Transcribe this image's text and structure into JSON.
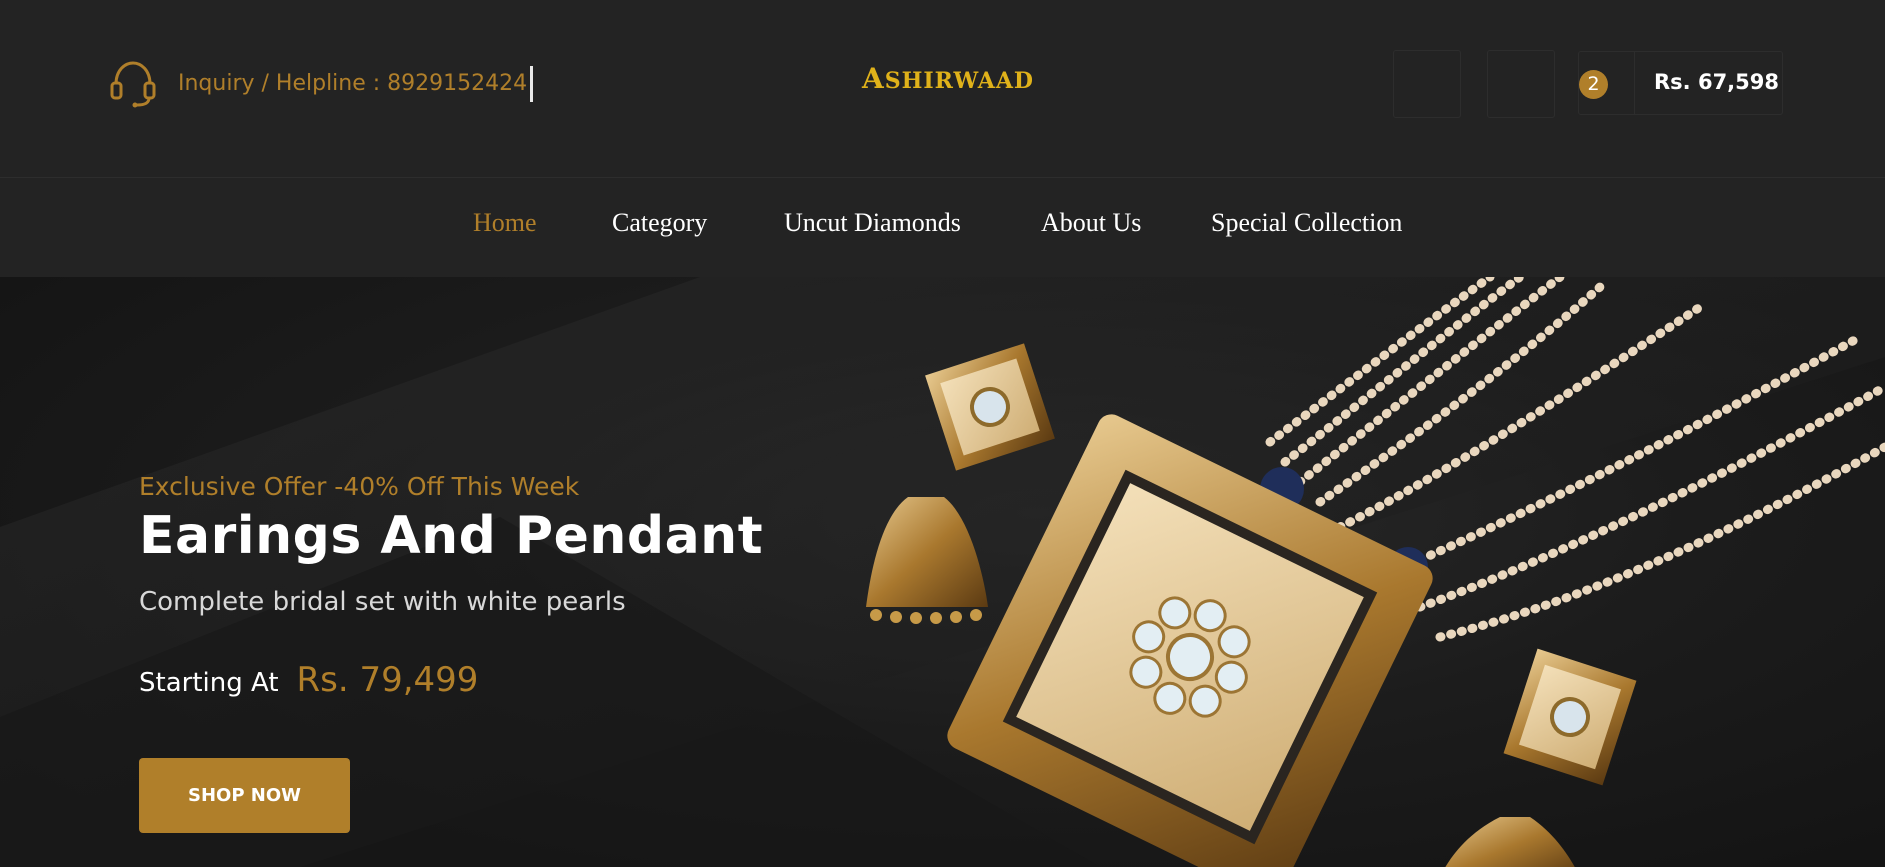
{
  "header": {
    "helpline_text": "Inquiry / Helpline : 8929152424",
    "logo_first": "A",
    "logo_rest": "SHIRWAAD",
    "cart_count": "2",
    "cart_total": "Rs. 67,598"
  },
  "nav": {
    "items": [
      {
        "label": "Home",
        "active": true
      },
      {
        "label": "Category"
      },
      {
        "label": "Uncut Diamonds"
      },
      {
        "label": "About Us"
      },
      {
        "label": "Special Collection"
      }
    ]
  },
  "hero": {
    "offer": "Exclusive Offer -40% Off This Week",
    "headline": "Earings And Pendant",
    "subtitle": "Complete bridal set with white pearls",
    "starting_label": "Starting At",
    "price": "Rs. 79,499",
    "cta": "SHOP NOW"
  },
  "colors": {
    "accent": "#b07f2a",
    "logo": "#e0b21a",
    "header_bg": "#232323",
    "hero_bg": "#1c1c1c"
  },
  "icons": {
    "helpline": "headset-icon"
  }
}
